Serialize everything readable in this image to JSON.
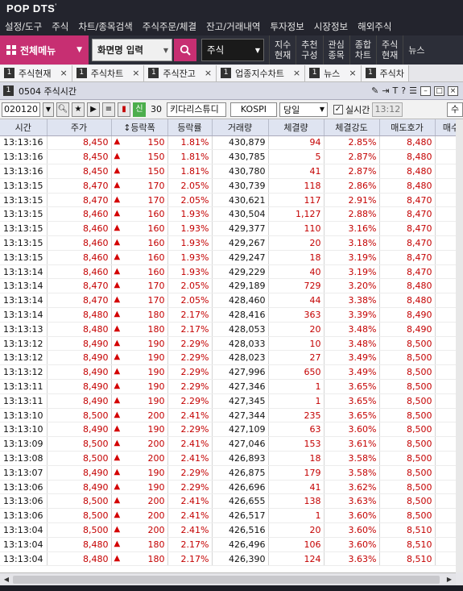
{
  "app": {
    "brand": "POP DTS",
    "brand_mark": "'"
  },
  "menu": [
    "설정/도구",
    "주식",
    "차트/종목검색",
    "주식주문/체결",
    "잔고/거래내역",
    "투자정보",
    "시장정보",
    "해외주식"
  ],
  "toolbar": {
    "all_menu_label": "전체메뉴",
    "screen_input_label": "화면명 입력",
    "stock_select_value": "주식",
    "quick_buttons": [
      "지수\n현재",
      "추천\n구성",
      "관심\n종목",
      "종합\n차트",
      "주식\n현재",
      "뉴스"
    ]
  },
  "tabs": [
    {
      "num": "1",
      "label": "주식현재"
    },
    {
      "num": "1",
      "label": "주식차트"
    },
    {
      "num": "1",
      "label": "주식잔고"
    },
    {
      "num": "1",
      "label": "업종지수차트"
    },
    {
      "num": "1",
      "label": "뉴스"
    },
    {
      "num": "1",
      "label": "주식차"
    }
  ],
  "window": {
    "num": "1",
    "title": "0504 주식시간"
  },
  "controls": {
    "code": "020120",
    "sin_label": "신",
    "leverage": "30",
    "stock_name": "키다리스튜디",
    "market": "KOSPI",
    "period": "당일",
    "realtime_label": "실시간",
    "realtime_checked": true,
    "time": "13:12",
    "su_label": "수"
  },
  "table": {
    "headers": [
      "시간",
      "주가",
      "↕등락폭",
      "등락률",
      "거래량",
      "체결량",
      "체결강도",
      "매도호가",
      "매수"
    ],
    "rows": [
      [
        "13:13:16",
        "8,450",
        "150",
        "1.81%",
        "430,879",
        "94",
        "2.85%",
        "8,480"
      ],
      [
        "13:13:16",
        "8,450",
        "150",
        "1.81%",
        "430,785",
        "5",
        "2.87%",
        "8,480"
      ],
      [
        "13:13:16",
        "8,450",
        "150",
        "1.81%",
        "430,780",
        "41",
        "2.87%",
        "8,480"
      ],
      [
        "13:13:15",
        "8,470",
        "170",
        "2.05%",
        "430,739",
        "118",
        "2.86%",
        "8,480"
      ],
      [
        "13:13:15",
        "8,470",
        "170",
        "2.05%",
        "430,621",
        "117",
        "2.91%",
        "8,470"
      ],
      [
        "13:13:15",
        "8,460",
        "160",
        "1.93%",
        "430,504",
        "1,127",
        "2.88%",
        "8,470"
      ],
      [
        "13:13:15",
        "8,460",
        "160",
        "1.93%",
        "429,377",
        "110",
        "3.16%",
        "8,470"
      ],
      [
        "13:13:15",
        "8,460",
        "160",
        "1.93%",
        "429,267",
        "20",
        "3.18%",
        "8,470"
      ],
      [
        "13:13:15",
        "8,460",
        "160",
        "1.93%",
        "429,247",
        "18",
        "3.19%",
        "8,470"
      ],
      [
        "13:13:14",
        "8,460",
        "160",
        "1.93%",
        "429,229",
        "40",
        "3.19%",
        "8,470"
      ],
      [
        "13:13:14",
        "8,470",
        "170",
        "2.05%",
        "429,189",
        "729",
        "3.20%",
        "8,480"
      ],
      [
        "13:13:14",
        "8,470",
        "170",
        "2.05%",
        "428,460",
        "44",
        "3.38%",
        "8,480"
      ],
      [
        "13:13:14",
        "8,480",
        "180",
        "2.17%",
        "428,416",
        "363",
        "3.39%",
        "8,490"
      ],
      [
        "13:13:13",
        "8,480",
        "180",
        "2.17%",
        "428,053",
        "20",
        "3.48%",
        "8,490"
      ],
      [
        "13:13:12",
        "8,490",
        "190",
        "2.29%",
        "428,033",
        "10",
        "3.48%",
        "8,500"
      ],
      [
        "13:13:12",
        "8,490",
        "190",
        "2.29%",
        "428,023",
        "27",
        "3.49%",
        "8,500"
      ],
      [
        "13:13:12",
        "8,490",
        "190",
        "2.29%",
        "427,996",
        "650",
        "3.49%",
        "8,500"
      ],
      [
        "13:13:11",
        "8,490",
        "190",
        "2.29%",
        "427,346",
        "1",
        "3.65%",
        "8,500"
      ],
      [
        "13:13:11",
        "8,490",
        "190",
        "2.29%",
        "427,345",
        "1",
        "3.65%",
        "8,500"
      ],
      [
        "13:13:10",
        "8,500",
        "200",
        "2.41%",
        "427,344",
        "235",
        "3.65%",
        "8,500"
      ],
      [
        "13:13:10",
        "8,490",
        "190",
        "2.29%",
        "427,109",
        "63",
        "3.60%",
        "8,500"
      ],
      [
        "13:13:09",
        "8,500",
        "200",
        "2.41%",
        "427,046",
        "153",
        "3.61%",
        "8,500"
      ],
      [
        "13:13:08",
        "8,500",
        "200",
        "2.41%",
        "426,893",
        "18",
        "3.58%",
        "8,500"
      ],
      [
        "13:13:07",
        "8,490",
        "190",
        "2.29%",
        "426,875",
        "179",
        "3.58%",
        "8,500"
      ],
      [
        "13:13:06",
        "8,490",
        "190",
        "2.29%",
        "426,696",
        "41",
        "3.62%",
        "8,500"
      ],
      [
        "13:13:06",
        "8,500",
        "200",
        "2.41%",
        "426,655",
        "138",
        "3.63%",
        "8,500"
      ],
      [
        "13:13:06",
        "8,500",
        "200",
        "2.41%",
        "426,517",
        "1",
        "3.60%",
        "8,500"
      ],
      [
        "13:13:04",
        "8,500",
        "200",
        "2.41%",
        "426,516",
        "20",
        "3.60%",
        "8,510"
      ],
      [
        "13:13:04",
        "8,480",
        "180",
        "2.17%",
        "426,496",
        "106",
        "3.60%",
        "8,510"
      ],
      [
        "13:13:04",
        "8,480",
        "180",
        "2.17%",
        "426,390",
        "124",
        "3.63%",
        "8,510"
      ]
    ],
    "up_rows_blue_volume": [
      5,
      10,
      12,
      16,
      19,
      21,
      23,
      25,
      28,
      29
    ]
  },
  "colors": {
    "accent": "#c72f72",
    "up": "#c40000",
    "header_bg": "#dfe4f1"
  }
}
